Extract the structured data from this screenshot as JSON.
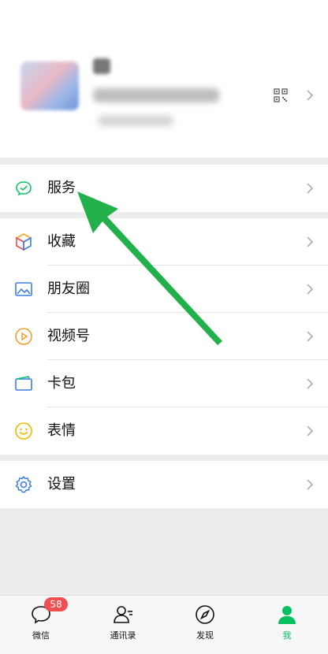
{
  "menu": {
    "service": "服务",
    "favorites": "收藏",
    "moments": "朋友圈",
    "channels": "视频号",
    "cards": "卡包",
    "stickers": "表情",
    "settings": "设置"
  },
  "tabbar": {
    "chats": "微信",
    "chats_badge": "58",
    "contacts": "通讯录",
    "discover": "发现",
    "me": "我"
  },
  "colors": {
    "accent": "#07c160",
    "badge": "#f04f4f",
    "arrow": "#22b04b"
  }
}
